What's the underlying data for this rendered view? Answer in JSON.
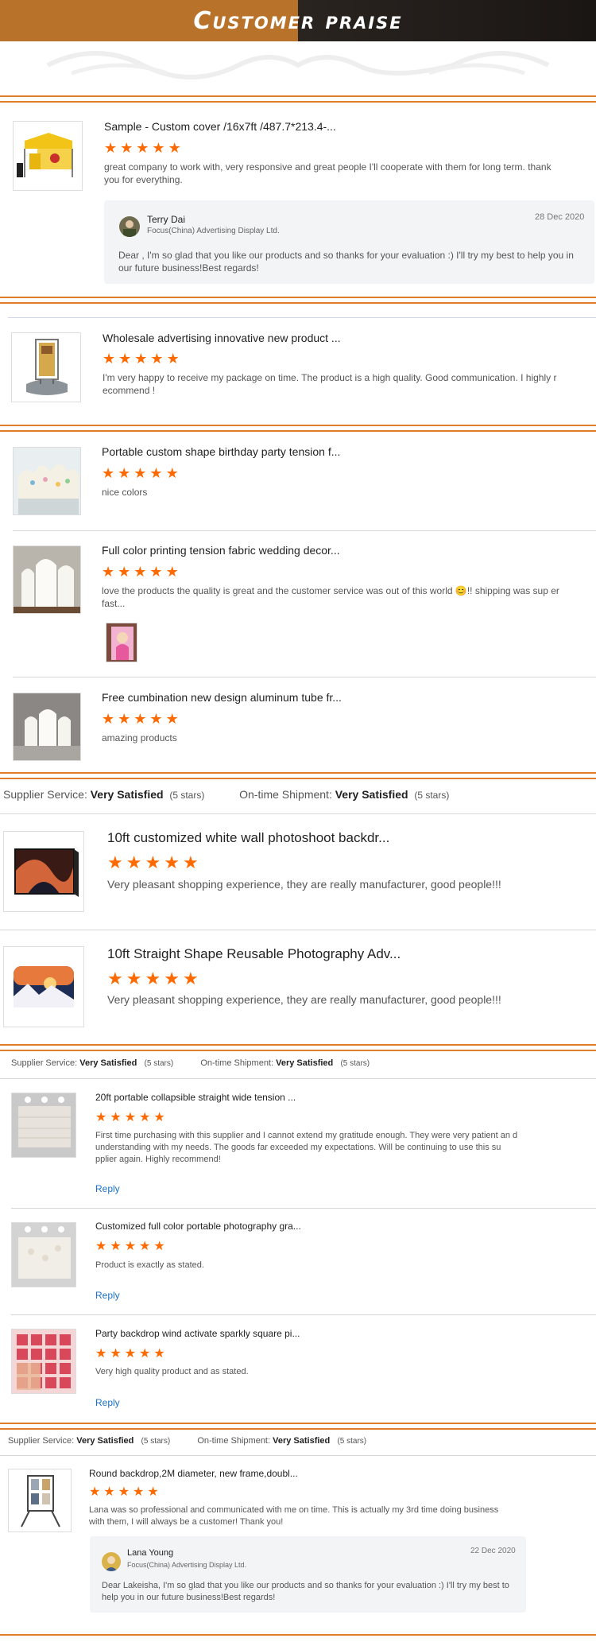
{
  "banner": {
    "title": "Customer  praise"
  },
  "colors": {
    "accent_rule": "#e07d2a",
    "star": "#ff6a00",
    "link": "#1a73c8"
  },
  "block1": {
    "product_title": "Sample - Custom cover /16x7ft /487.7*213.4-...",
    "rating": 5,
    "comment": "great company to work with, very responsive and great people I'll cooperate with them for long term. thank you for everything.",
    "reply": {
      "name": "Terry Dai",
      "company": "Focus(China) Advertising Display Ltd.",
      "date": "28 Dec 2020",
      "text": "Dear , I'm so glad that you like our products and so thanks for your evaluation :) I'll try my best to help you in our future business!Best regards!"
    }
  },
  "block2": {
    "product_title": "Wholesale advertising innovative new product ...",
    "rating": 5,
    "comment": "I'm very happy to receive my package on time. The product is a high quality. Good communication. I highly r ecommend !"
  },
  "block3": {
    "items": [
      {
        "product_title": "Portable custom shape birthday party tension f...",
        "rating": 5,
        "comment": "nice colors"
      },
      {
        "product_title": "Full color printing tension fabric wedding decor...",
        "rating": 5,
        "comment": "love the products the quality is great and the customer service was out of this world 😊!! shipping was sup er fast..."
      },
      {
        "product_title": "Free cumbination new design aluminum tube fr...",
        "rating": 5,
        "comment": "amazing products"
      }
    ]
  },
  "summary1": {
    "service_label": "Supplier Service:",
    "service_value": "Very Satisfied",
    "service_stars": "(5 stars)",
    "ship_label": "On-time Shipment:",
    "ship_value": "Very Satisfied",
    "ship_stars": "(5 stars)"
  },
  "block4": {
    "items": [
      {
        "product_title": "10ft customized white wall photoshoot backdr...",
        "rating": 5,
        "comment": "Very pleasant shopping experience, they are really manufacturer, good people!!!"
      },
      {
        "product_title": "10ft Straight Shape Reusable Photography Adv...",
        "rating": 5,
        "comment": "Very pleasant shopping experience, they are really manufacturer, good people!!!"
      }
    ]
  },
  "summary2": {
    "service_label": "Supplier Service:",
    "service_value": "Very Satisfied",
    "service_stars": "(5 stars)",
    "ship_label": "On-time Shipment:",
    "ship_value": "Very Satisfied",
    "ship_stars": "(5 stars)"
  },
  "block5": {
    "reply_label": "Reply",
    "items": [
      {
        "product_title": "20ft portable collapsible straight wide tension ...",
        "rating": 5,
        "comment": "First time purchasing with this supplier and I cannot extend my gratitude enough. They were very patient an d understanding with my needs. The goods far exceeded my expectations. Will be continuing to use this su pplier again. Highly recommend!"
      },
      {
        "product_title": "Customized full color portable photography gra...",
        "rating": 5,
        "comment": "Product is exactly as stated."
      },
      {
        "product_title": "Party backdrop wind activate sparkly square pi...",
        "rating": 5,
        "comment": "Very high quality product and as stated."
      }
    ]
  },
  "summary3": {
    "service_label": "Supplier Service:",
    "service_value": "Very Satisfied",
    "service_stars": "(5 stars)",
    "ship_label": "On-time Shipment:",
    "ship_value": "Very Satisfied",
    "ship_stars": "(5 stars)"
  },
  "block6": {
    "product_title": "Round backdrop,2M diameter, new frame,doubl...",
    "rating": 5,
    "comment": "Lana was so professional and communicated with me on time. This is actually my 3rd time doing business with them,  I will always be a customer! Thank you!",
    "reply": {
      "name": "Lana Young",
      "company": "Focus(China) Advertising Display Ltd.",
      "date": "22 Dec 2020",
      "text": "Dear Lakeisha, I'm so glad that you like our products and so thanks for your evaluation :) I'll try my best to help you in our future business!Best regards!"
    }
  }
}
